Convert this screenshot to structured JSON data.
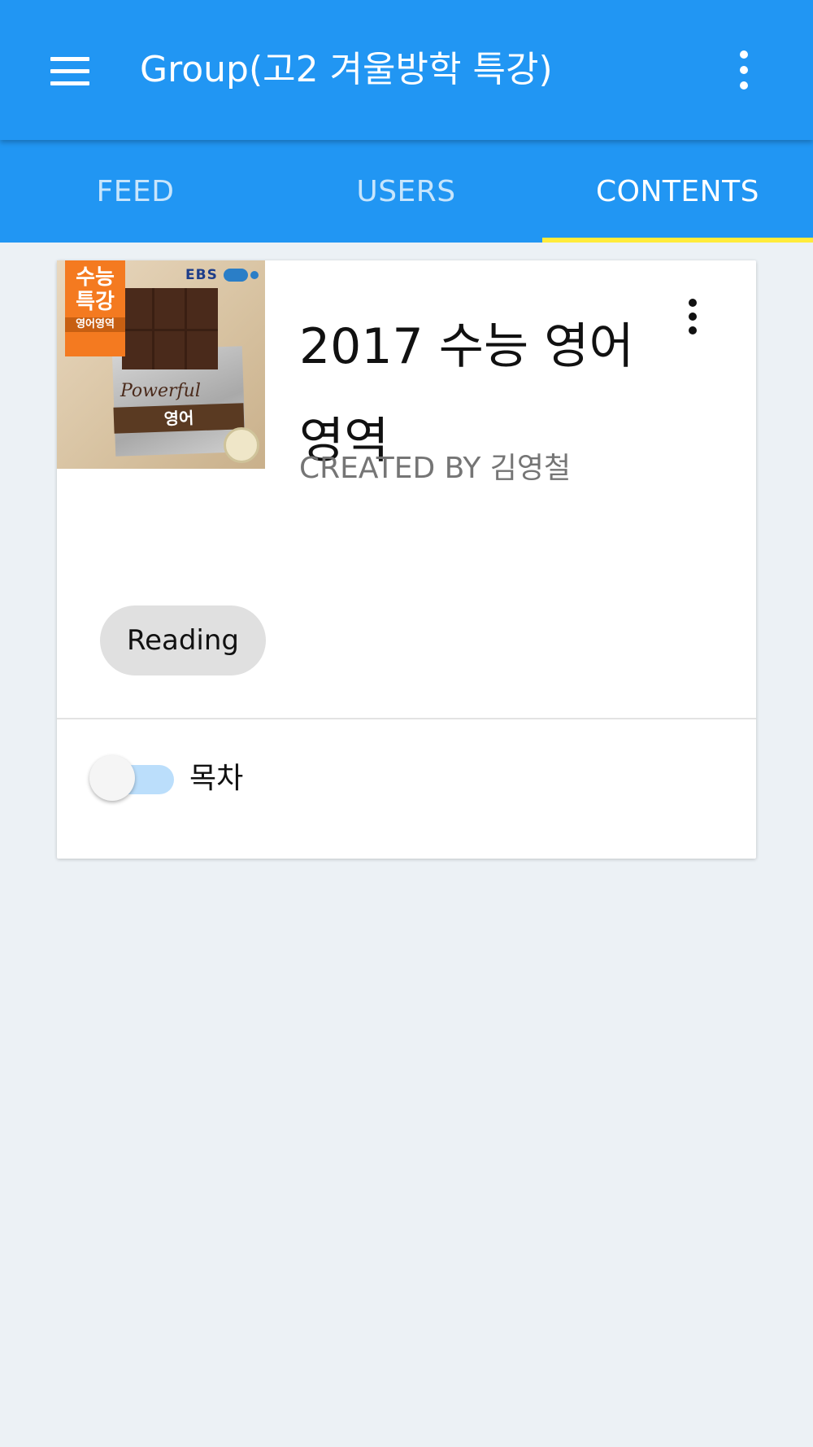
{
  "appbar": {
    "title": "Group(고2 겨울방학 특강)",
    "menu_icon": "hamburger-menu-icon",
    "overflow_icon": "more-vert-icon",
    "background_color": "#2196F3"
  },
  "tabs": [
    {
      "label": "FEED",
      "active": false
    },
    {
      "label": "USERS",
      "active": false
    },
    {
      "label": "CONTENTS",
      "active": true
    }
  ],
  "tab_indicator_color": "#FFEB3B",
  "card": {
    "cover": {
      "badge": "수능\n특강",
      "badge_sub": "영어영역",
      "publisher": "EBS",
      "script": "Powerful",
      "band": "영어"
    },
    "title": "2017 수능 영어 영역",
    "author": "CREATED BY 김영철",
    "menu_icon": "more-vert-icon",
    "chip": "Reading",
    "toggle": {
      "label": "목차",
      "on": false
    }
  }
}
